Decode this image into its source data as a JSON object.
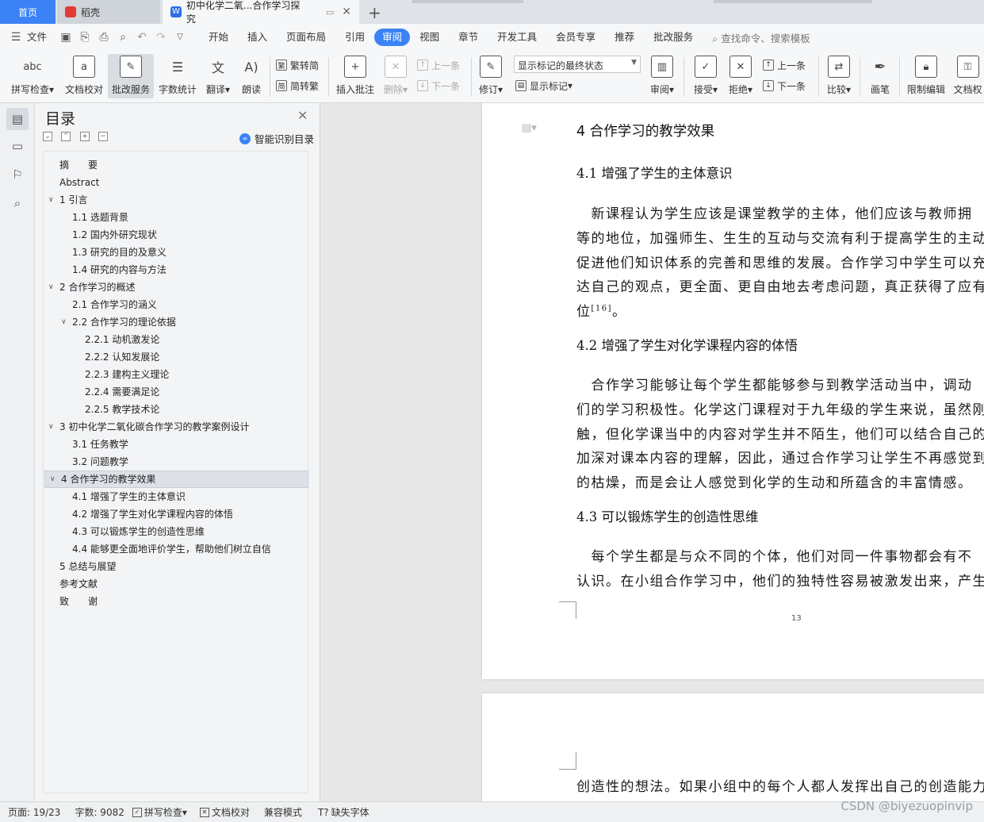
{
  "tabs": {
    "home": "首页",
    "daoke": "稻壳",
    "doc": "初中化学二氧...合作学习探究"
  },
  "menu": {
    "file": "文件",
    "items": [
      "开始",
      "插入",
      "页面布局",
      "引用",
      "审阅",
      "视图",
      "章节",
      "开发工具",
      "会员专享",
      "推荐",
      "批改服务"
    ],
    "active": "审阅",
    "search": "查找命令、搜索模板"
  },
  "ribbon": {
    "spell": "拼写检查",
    "doc_check": "文档校对",
    "correct_service": "批改服务",
    "word_count": "字数统计",
    "translate": "翻译",
    "read_aloud": "朗读",
    "trad_to_simp": "繁转简",
    "simp_to_trad": "简转繁",
    "insert_comment": "插入批注",
    "delete": "删除",
    "prev_comment": "上一条",
    "next_comment": "下一条",
    "track": "修订",
    "markup_select": "显示标记的最终状态",
    "show_markup": "显示标记",
    "review": "审阅",
    "accept": "接受",
    "reject": "拒绝",
    "prev_change": "上一条",
    "next_change": "下一条",
    "compare": "比较",
    "pen": "画笔",
    "restrict_edit": "限制编辑",
    "doc_rights": "文档权"
  },
  "toc": {
    "title": "目录",
    "smart": "智能识别目录",
    "items": [
      {
        "text": "摘　　要",
        "level": 0,
        "arrow": ""
      },
      {
        "text": "Abstract",
        "level": 0,
        "arrow": ""
      },
      {
        "text": "1  引言",
        "level": 0,
        "arrow": "v"
      },
      {
        "text": "1.1  选题背景",
        "level": 1,
        "arrow": ""
      },
      {
        "text": "1.2  国内外研究现状",
        "level": 1,
        "arrow": ""
      },
      {
        "text": "1.3  研究的目的及意义",
        "level": 1,
        "arrow": ""
      },
      {
        "text": "1.4  研究的内容与方法",
        "level": 1,
        "arrow": ""
      },
      {
        "text": "2  合作学习的概述",
        "level": 0,
        "arrow": "v"
      },
      {
        "text": "2.1  合作学习的涵义",
        "level": 1,
        "arrow": ""
      },
      {
        "text": "2.2  合作学习的理论依据",
        "level": 1,
        "arrow": "v"
      },
      {
        "text": "2.2.1 动机激发论",
        "level": 2,
        "arrow": ""
      },
      {
        "text": "2.2.2 认知发展论",
        "level": 2,
        "arrow": ""
      },
      {
        "text": "2.2.3 建构主义理论",
        "level": 2,
        "arrow": ""
      },
      {
        "text": "2.2.4 需要满足论",
        "level": 2,
        "arrow": ""
      },
      {
        "text": "2.2.5 教学技术论",
        "level": 2,
        "arrow": ""
      },
      {
        "text": "3  初中化学二氧化碳合作学习的教学案例设计",
        "level": 0,
        "arrow": "v"
      },
      {
        "text": "3.1  任务教学",
        "level": 1,
        "arrow": ""
      },
      {
        "text": "3.2  问题教学",
        "level": 1,
        "arrow": ""
      },
      {
        "text": "4  合作学习的教学效果",
        "level": 0,
        "arrow": "v",
        "selected": true
      },
      {
        "text": "4.1 增强了学生的主体意识",
        "level": 1,
        "arrow": ""
      },
      {
        "text": "4.2 增强了学生对化学课程内容的体悟",
        "level": 1,
        "arrow": ""
      },
      {
        "text": "4.3 可以锻炼学生的创造性思维",
        "level": 1,
        "arrow": ""
      },
      {
        "text": "4.4 能够更全面地评价学生，帮助他们树立自信",
        "level": 1,
        "arrow": ""
      },
      {
        "text": "5  总结与展望",
        "level": 0,
        "arrow": ""
      },
      {
        "text": "参考文献",
        "level": 0,
        "arrow": ""
      },
      {
        "text": "致　　谢",
        "level": 0,
        "arrow": ""
      }
    ]
  },
  "document": {
    "h4": "4  合作学习的教学效果",
    "h41": "4.1 增强了学生的主体意识",
    "p41": [
      "　新课程认为学生应该是课堂教学的主体，他们应该与教师拥",
      "等的地位，加强师生、生生的互动与交流有利于提高学生的主动",
      "促进他们知识体系的完善和思维的发展。合作学习中学生可以充",
      "达自己的观点，更全面、更自由地去考虑问题，真正获得了应有",
      "位"
    ],
    "cite": "[16]",
    "p41_end": "。",
    "h42": "4.2 增强了学生对化学课程内容的体悟",
    "p42": [
      "　合作学习能够让每个学生都能够参与到教学活动当中，调动",
      "们的学习积极性。化学这门课程对于九年级的学生来说，虽然刚",
      "触，但化学课当中的内容对学生并不陌生，他们可以结合自己的",
      "加深对课本内容的理解，因此，通过合作学习让学生不再感觉到",
      "的枯燥，而是会让人感觉到化学的生动和所蕴含的丰富情感。"
    ],
    "h43": "4.3 可以锻炼学生的创造性思维",
    "p43": [
      "　每个学生都是与众不同的个体，他们对同一件事物都会有不",
      "认识。在小组合作学习中，他们的独特性容易被激发出来，产生"
    ],
    "page_number": "13",
    "next_page_line": "创造性的想法。如果小组中的每个人都人发挥出自己的创造能力"
  },
  "status": {
    "page": "页面: 19/23",
    "words": "字数: 9082",
    "spell": "拼写检查",
    "doc_check": "文档校对",
    "compat": "兼容模式",
    "missing_font": "缺失字体"
  },
  "watermark": "CSDN @biyezuopinvip",
  "colors": {
    "accent": "#3b82f6",
    "daoke_red": "#e53935"
  }
}
